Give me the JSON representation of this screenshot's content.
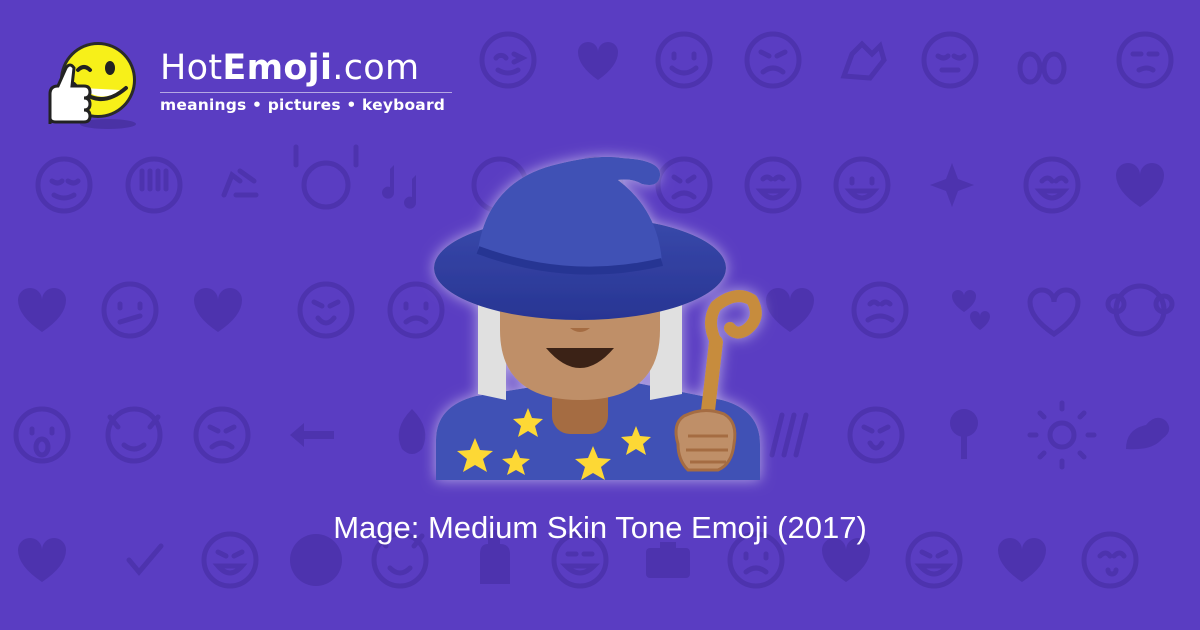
{
  "brand": {
    "name_prefix": "Hot",
    "name_bold": "Emoji",
    "name_suffix": ".com",
    "tagline": "meanings • pictures • keyboard"
  },
  "emoji": {
    "caption": "Mage: Medium Skin Tone Emoji (2017)",
    "icon": "mage-medium-skin-tone-icon"
  },
  "colors": {
    "background": "#5a3dc2",
    "pattern": "#4d33ae",
    "hat": "#3f51b5",
    "skin": "#bf8f68",
    "star": "#fdd835",
    "staff": "#c78c3c"
  }
}
